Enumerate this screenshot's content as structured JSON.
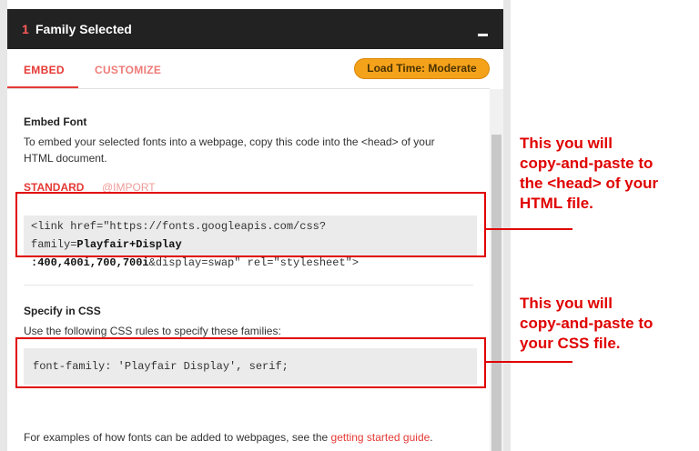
{
  "header": {
    "count": "1",
    "label": "Family Selected"
  },
  "tabs": {
    "embed": "EMBED",
    "customize": "CUSTOMIZE",
    "load_time": "Load Time: Moderate"
  },
  "embed_font": {
    "title": "Embed Font",
    "desc_line1": "To embed your selected fonts into a webpage, copy this code into the <head> of your",
    "desc_line2": "HTML document.",
    "subtab_standard": "STANDARD",
    "subtab_import": "@IMPORT",
    "code_line1_a": "<link href=\"https://fonts.googleapis.com/css?family=",
    "code_line1_b": "Playfair+Display",
    "code_line2_a": ":400,400i,700,700i",
    "code_line2_b": "&display=swap\" rel=\"stylesheet\">"
  },
  "specify_css": {
    "title": "Specify in CSS",
    "desc": "Use the following CSS rules to specify these families:",
    "code": "font-family: 'Playfair Display', serif;"
  },
  "footer": {
    "text": "For examples of how fonts can be added to webpages, see the ",
    "link": "getting started guide",
    "end": "."
  },
  "annotations": {
    "a1_line1": "This you will",
    "a1_line2": "copy-and-paste to",
    "a1_line3": "the <head> of your",
    "a1_line4": "HTML file.",
    "a2_line1": "This you will",
    "a2_line2": "copy-and-paste to",
    "a2_line3": "your CSS file."
  },
  "colors": {
    "accent": "#e53935",
    "badge": "#f5a21b",
    "annotation": "#e00000",
    "header_bg": "#222222"
  }
}
